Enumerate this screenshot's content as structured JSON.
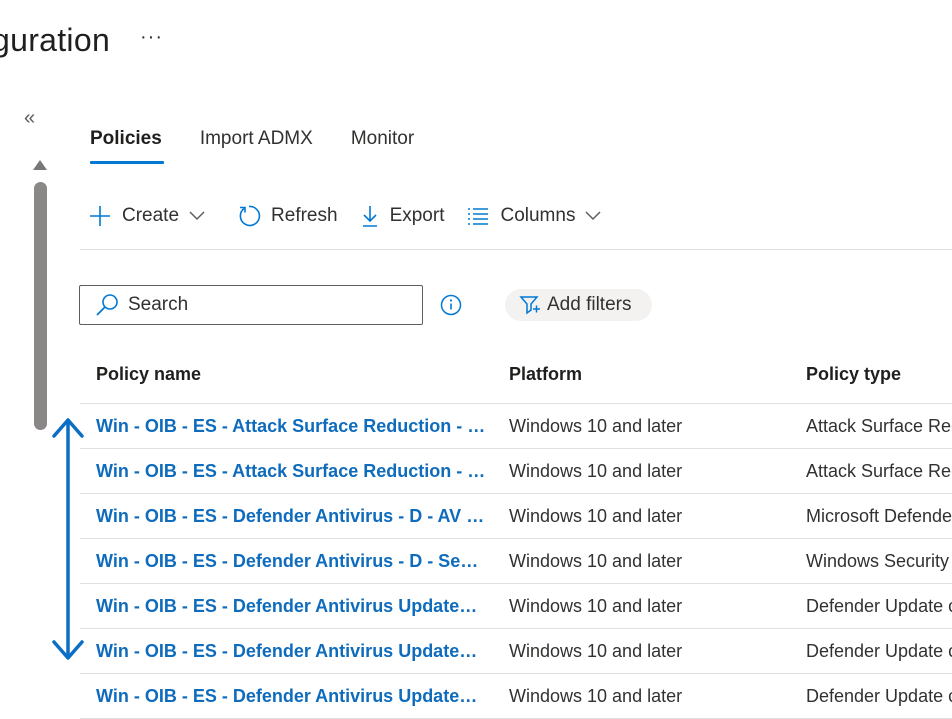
{
  "page": {
    "title": "guration",
    "more_label": "···",
    "collapse_label": "«"
  },
  "tabs": [
    {
      "label": "Policies",
      "active": true
    },
    {
      "label": "Import ADMX",
      "active": false
    },
    {
      "label": "Monitor",
      "active": false
    }
  ],
  "toolbar": {
    "create_label": "Create",
    "refresh_label": "Refresh",
    "export_label": "Export",
    "columns_label": "Columns"
  },
  "search": {
    "placeholder": "Search",
    "value": ""
  },
  "filters": {
    "add_filters_label": "Add filters"
  },
  "table": {
    "columns": [
      "Policy name",
      "Platform",
      "Policy type"
    ],
    "rows": [
      [
        "Win - OIB - ES - Attack Surface Reduction - D - ...",
        "Windows 10 and later",
        "Attack Surface Red"
      ],
      [
        "Win - OIB - ES - Attack Surface Reduction - D - ...",
        "Windows 10 and later",
        "Attack Surface Red"
      ],
      [
        "Win - OIB - ES - Defender Antivirus - D - AV C...",
        "Windows 10 and later",
        "Microsoft Defender"
      ],
      [
        "Win - OIB - ES - Defender Antivirus - D - Secur...",
        "Windows 10 and later",
        "Windows Security E"
      ],
      [
        "Win - OIB - ES - Defender Antivirus Updates - ...",
        "Windows 10 and later",
        "Defender Update c"
      ],
      [
        "Win - OIB - ES - Defender Antivirus Updates - ...",
        "Windows 10 and later",
        "Defender Update c"
      ],
      [
        "Win - OIB - ES - Defender Antivirus Updates - ...",
        "Windows 10 and later",
        "Defender Update c"
      ]
    ]
  },
  "colors": {
    "accent": "#0078d4",
    "link": "#0f6cbd",
    "annotation_arrow": "#0b6ec5"
  },
  "icons": {
    "create": "plus-icon",
    "refresh": "refresh-icon",
    "export": "download-icon",
    "columns": "list-icon",
    "search": "search-icon",
    "info": "info-icon",
    "filter": "filter-icon"
  }
}
